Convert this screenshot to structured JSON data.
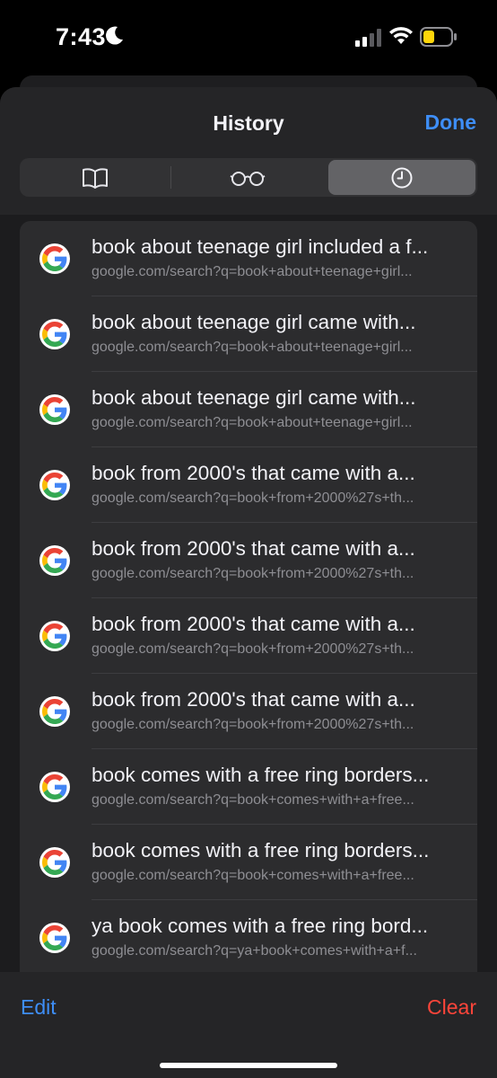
{
  "status_bar": {
    "time": "7:43",
    "moon_icon": "moon-icon",
    "signal_icon": "cellular-signal-icon",
    "wifi_icon": "wifi-icon",
    "battery_icon": "battery-low-power-icon",
    "battery_color": "#ffd60a"
  },
  "header": {
    "title": "History",
    "done_label": "Done"
  },
  "segments": [
    {
      "icon": "bookmarks-book-icon",
      "selected": false
    },
    {
      "icon": "reading-list-glasses-icon",
      "selected": false
    },
    {
      "icon": "history-clock-icon",
      "selected": true
    }
  ],
  "history": [
    {
      "title": "book about teenage girl included a f...",
      "url": "google.com/search?q=book+about+teenage+girl...",
      "icon": "google-icon"
    },
    {
      "title": "book about teenage girl came with...",
      "url": "google.com/search?q=book+about+teenage+girl...",
      "icon": "google-icon"
    },
    {
      "title": "book about teenage girl came with...",
      "url": "google.com/search?q=book+about+teenage+girl...",
      "icon": "google-icon"
    },
    {
      "title": "book from 2000's that came with a...",
      "url": "google.com/search?q=book+from+2000%27s+th...",
      "icon": "google-icon"
    },
    {
      "title": "book from 2000's that came with a...",
      "url": "google.com/search?q=book+from+2000%27s+th...",
      "icon": "google-icon"
    },
    {
      "title": "book from 2000's that came with a...",
      "url": "google.com/search?q=book+from+2000%27s+th...",
      "icon": "google-icon"
    },
    {
      "title": "book from 2000's that came with a...",
      "url": "google.com/search?q=book+from+2000%27s+th...",
      "icon": "google-icon"
    },
    {
      "title": "book comes with a free ring borders...",
      "url": "google.com/search?q=book+comes+with+a+free...",
      "icon": "google-icon"
    },
    {
      "title": "book comes with a free ring borders...",
      "url": "google.com/search?q=book+comes+with+a+free...",
      "icon": "google-icon"
    },
    {
      "title": "ya book comes with a free ring bord...",
      "url": "google.com/search?q=ya+book+comes+with+a+f...",
      "icon": "google-icon"
    }
  ],
  "toolbar": {
    "edit_label": "Edit",
    "clear_label": "Clear"
  },
  "colors": {
    "accent_blue": "#3e8ef7",
    "destructive_red": "#ff453a"
  }
}
